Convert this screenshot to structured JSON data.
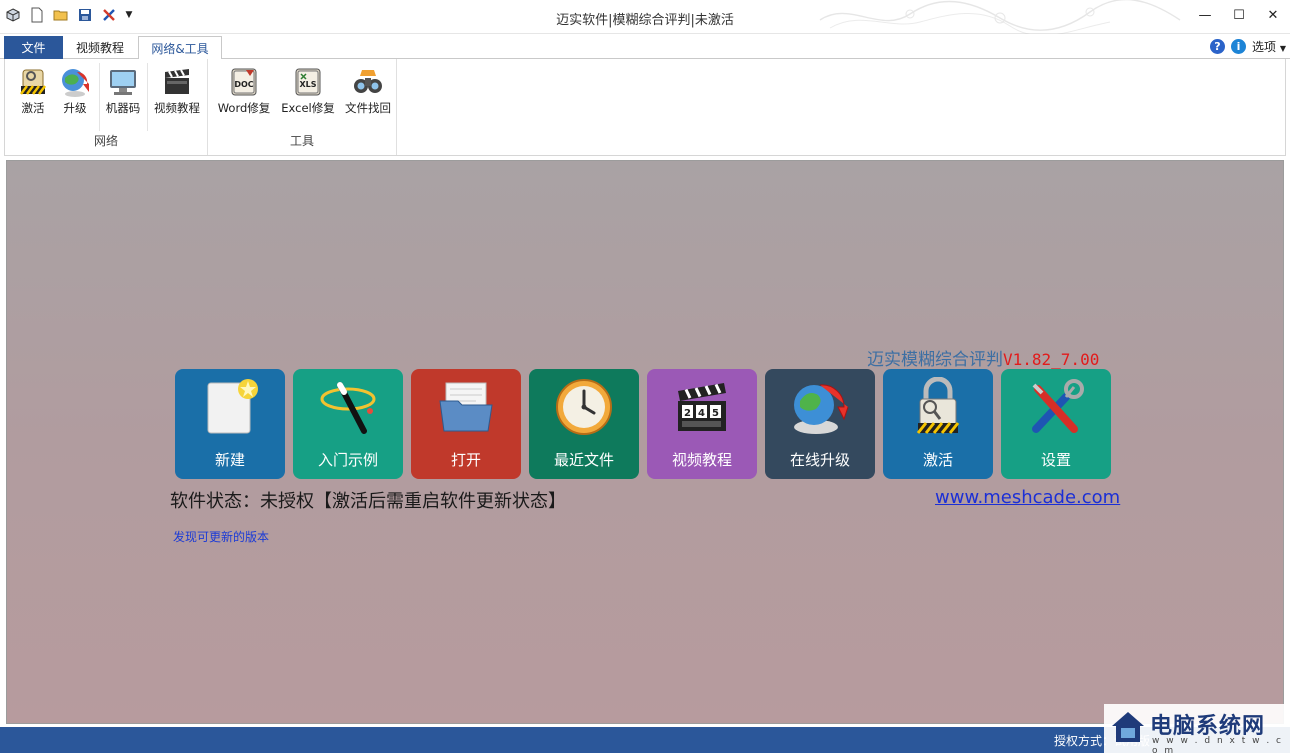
{
  "window": {
    "title": "迈实软件|模糊综合评判|未激活"
  },
  "tabs": {
    "file": "文件",
    "video": "视频教程",
    "network_tools": "网络&工具",
    "options": "选项"
  },
  "ribbon": {
    "groups": [
      {
        "label": "网络",
        "buttons": [
          {
            "label": "激活",
            "icon": "activate-icon"
          },
          {
            "label": "升级",
            "icon": "upgrade-icon"
          },
          {
            "label": "机器码",
            "icon": "machine-code-icon"
          },
          {
            "label": "视频教程",
            "icon": "video-clapper-icon"
          }
        ]
      },
      {
        "label": "工具",
        "buttons": [
          {
            "label": "Word修复",
            "icon": "doc-icon"
          },
          {
            "label": "Excel修复",
            "icon": "xls-icon"
          },
          {
            "label": "文件找回",
            "icon": "binoculars-icon"
          }
        ]
      }
    ]
  },
  "main": {
    "product_name": "迈实模糊综合评判",
    "version": "V1.82_7.00",
    "tiles": [
      {
        "label": "新建",
        "color": "#1a6fa8",
        "icon": "new-file-icon"
      },
      {
        "label": "入门示例",
        "color": "#16a085",
        "icon": "magic-wand-icon"
      },
      {
        "label": "打开",
        "color": "#c0392b",
        "icon": "open-folder-icon"
      },
      {
        "label": "最近文件",
        "color": "#0e7a5c",
        "icon": "clock-icon"
      },
      {
        "label": "视频教程",
        "color": "#9b59b6",
        "icon": "clapper-icon"
      },
      {
        "label": "在线升级",
        "color": "#34495e",
        "icon": "globe-upgrade-icon"
      },
      {
        "label": "激活",
        "color": "#1a6fa8",
        "icon": "lock-keys-icon"
      },
      {
        "label": "设置",
        "color": "#16a085",
        "icon": "tools-icon"
      }
    ],
    "status_text": "软件状态：未授权【激活后需重启软件更新状态】",
    "website": "www.meshcade.com",
    "update_link": "发现可更新的版本"
  },
  "statusbar": {
    "text": "授权方式：试用版"
  },
  "watermark": {
    "title": "电脑系统网",
    "url": "w w w . d n x t w . c o m"
  },
  "colors": {
    "accent": "#2b579a",
    "status_red": "#e21b1b"
  }
}
